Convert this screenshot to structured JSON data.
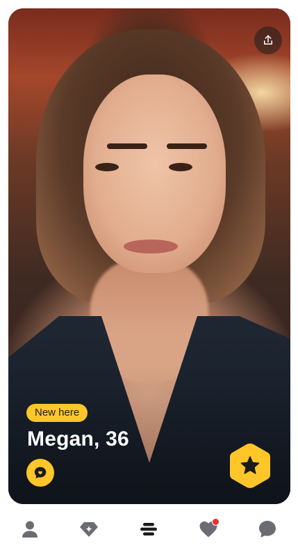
{
  "profile": {
    "badge": "New here",
    "name_age": "Megan, 36"
  },
  "icons": {
    "share": "share-icon",
    "chat": "chat-heart-icon",
    "superswipe": "star-hexagon-icon"
  },
  "tabbar": {
    "items": [
      {
        "icon": "profile-icon",
        "active": false
      },
      {
        "icon": "diamond-sparkle-icon",
        "active": false
      },
      {
        "icon": "stack-icon",
        "active": true
      },
      {
        "icon": "heart-icon",
        "active": false,
        "has_notification": true
      },
      {
        "icon": "chat-bubble-icon",
        "active": false
      }
    ]
  },
  "colors": {
    "accent": "#ffc629",
    "tab_icon": "#6b6b73",
    "tab_active": "#1a1a1a",
    "notification": "#e8312f"
  }
}
